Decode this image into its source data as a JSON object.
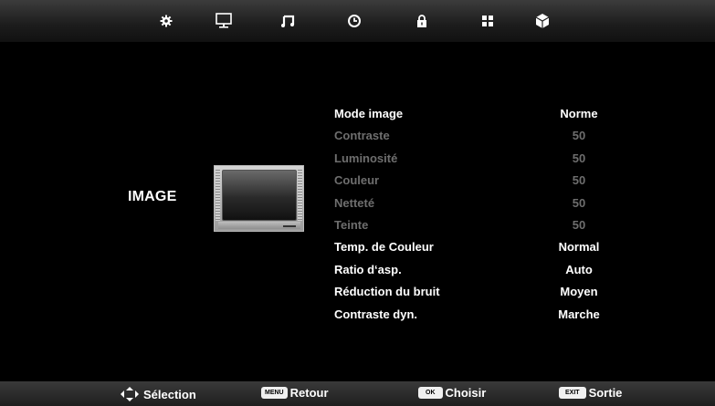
{
  "tabs": [
    {
      "icon": "gear-icon"
    },
    {
      "icon": "monitor-icon"
    },
    {
      "icon": "music-note-icon"
    },
    {
      "icon": "clock-icon"
    },
    {
      "icon": "lock-icon"
    },
    {
      "icon": "apps-grid-icon"
    },
    {
      "icon": "cube-icon"
    }
  ],
  "section": {
    "title": "IMAGE"
  },
  "menu": [
    {
      "label": "Mode image",
      "value": "Norme",
      "enabled": true
    },
    {
      "label": "Contraste",
      "value": "50",
      "enabled": false
    },
    {
      "label": "Luminosité",
      "value": "50",
      "enabled": false
    },
    {
      "label": "Couleur",
      "value": "50",
      "enabled": false
    },
    {
      "label": "Netteté",
      "value": "50",
      "enabled": false
    },
    {
      "label": "Teinte",
      "value": "50",
      "enabled": false
    },
    {
      "label": "Temp. de Couleur",
      "value": "Normal",
      "enabled": true
    },
    {
      "label": "Ratio d‘asp.",
      "value": "Auto",
      "enabled": true
    },
    {
      "label": "Réduction du bruit",
      "value": "Moyen",
      "enabled": true
    },
    {
      "label": "Contraste dyn.",
      "value": "Marche",
      "enabled": true
    }
  ],
  "hints": {
    "select": {
      "label": "Sélection"
    },
    "back": {
      "key": "MENU",
      "label": "Retour"
    },
    "choose": {
      "key": "OK",
      "label": "Choisir"
    },
    "exit": {
      "key": "EXIT",
      "label": "Sortie"
    }
  },
  "colors": {
    "accent_text": "#ffffff",
    "disabled_text": "#6e6e6e",
    "background": "#000000"
  }
}
